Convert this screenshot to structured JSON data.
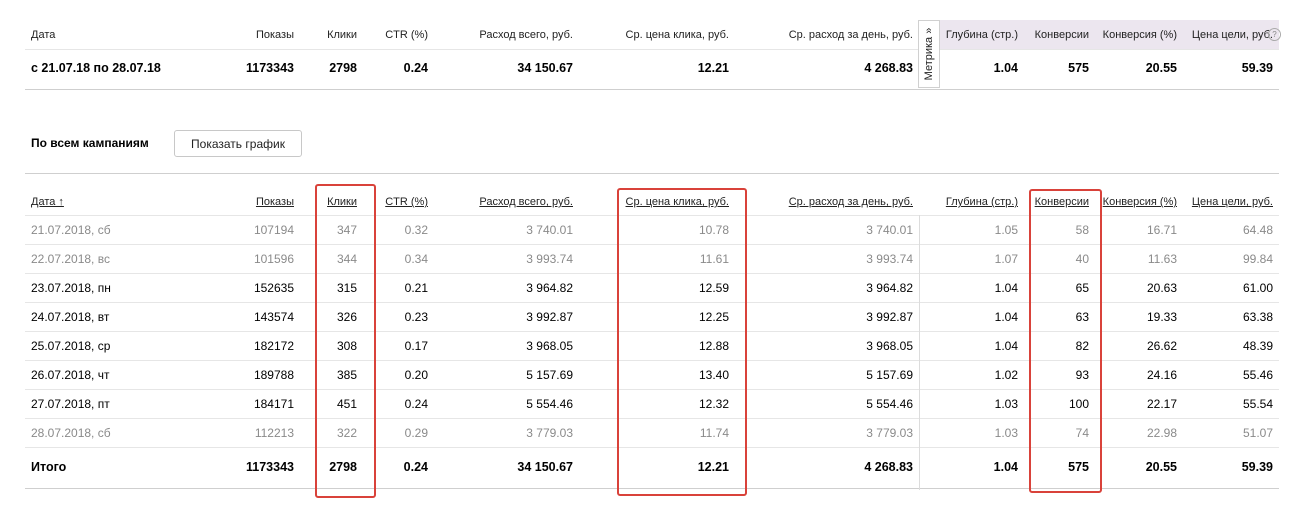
{
  "summary": {
    "headers": [
      "Дата",
      "Показы",
      "Клики",
      "CTR (%)",
      "Расход всего, руб.",
      "Ср. цена клика, руб.",
      "Ср. расход за день, руб.",
      "Глубина (стр.)",
      "Конверсии",
      "Конверсия (%)",
      "Цена цели, руб."
    ],
    "row": [
      "с 21.07.18 по 28.07.18",
      "1173343",
      "2798",
      "0.24",
      "34 150.67",
      "12.21",
      "4 268.83",
      "1.04",
      "575",
      "20.55",
      "59.39"
    ]
  },
  "metrika_tab": {
    "label": "Метрика »",
    "help": "?"
  },
  "campaigns": {
    "title": "По всем кампаниям",
    "chart_button": "Показать график"
  },
  "table": {
    "headers": [
      "Дата ↑",
      "Показы",
      "Клики",
      "CTR (%)",
      "Расход всего, руб.",
      "Ср. цена клика, руб.",
      "Ср. расход за день, руб.",
      "Глубина (стр.)",
      "Конверсии",
      "Конверсия (%)",
      "Цена цели, руб."
    ],
    "rows": [
      {
        "grey": true,
        "cells": [
          "21.07.2018, сб",
          "107194",
          "347",
          "0.32",
          "3 740.01",
          "10.78",
          "3 740.01",
          "1.05",
          "58",
          "16.71",
          "64.48"
        ]
      },
      {
        "grey": true,
        "cells": [
          "22.07.2018, вс",
          "101596",
          "344",
          "0.34",
          "3 993.74",
          "11.61",
          "3 993.74",
          "1.07",
          "40",
          "11.63",
          "99.84"
        ]
      },
      {
        "grey": false,
        "cells": [
          "23.07.2018, пн",
          "152635",
          "315",
          "0.21",
          "3 964.82",
          "12.59",
          "3 964.82",
          "1.04",
          "65",
          "20.63",
          "61.00"
        ]
      },
      {
        "grey": false,
        "cells": [
          "24.07.2018, вт",
          "143574",
          "326",
          "0.23",
          "3 992.87",
          "12.25",
          "3 992.87",
          "1.04",
          "63",
          "19.33",
          "63.38"
        ]
      },
      {
        "grey": false,
        "cells": [
          "25.07.2018, ср",
          "182172",
          "308",
          "0.17",
          "3 968.05",
          "12.88",
          "3 968.05",
          "1.04",
          "82",
          "26.62",
          "48.39"
        ]
      },
      {
        "grey": false,
        "cells": [
          "26.07.2018, чт",
          "189788",
          "385",
          "0.20",
          "5 157.69",
          "13.40",
          "5 157.69",
          "1.02",
          "93",
          "24.16",
          "55.46"
        ]
      },
      {
        "grey": false,
        "cells": [
          "27.07.2018, пт",
          "184171",
          "451",
          "0.24",
          "5 554.46",
          "12.32",
          "5 554.46",
          "1.03",
          "100",
          "22.17",
          "55.54"
        ]
      },
      {
        "grey": true,
        "cells": [
          "28.07.2018, сб",
          "112213",
          "322",
          "0.29",
          "3 779.03",
          "11.74",
          "3 779.03",
          "1.03",
          "74",
          "22.98",
          "51.07"
        ]
      }
    ],
    "total": [
      "Итого",
      "1173343",
      "2798",
      "0.24",
      "34 150.67",
      "12.21",
      "4 268.83",
      "1.04",
      "575",
      "20.55",
      "59.39"
    ]
  },
  "highlight_color": "#d9423a"
}
